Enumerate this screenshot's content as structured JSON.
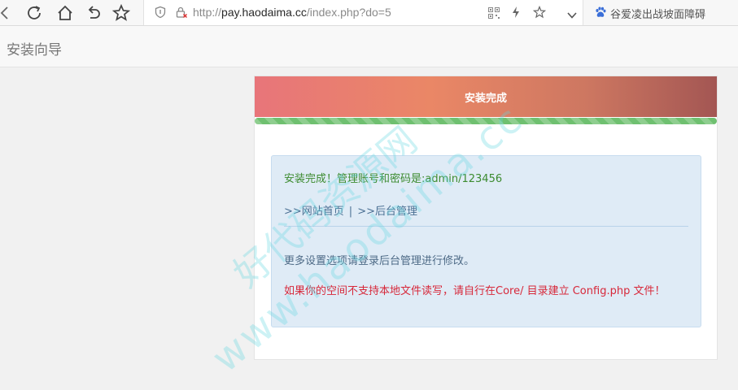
{
  "browser": {
    "url": {
      "scheme": "http://",
      "host": "pay.haodaima.cc",
      "path": "/index.php?do=5"
    },
    "search_hint": "谷爱凌出战坡面障碍"
  },
  "page": {
    "brand": "安装向导"
  },
  "panel": {
    "title": "安装完成",
    "progress_percent": 100,
    "success_message": "安装完成！管理账号和密码是:admin/123456",
    "link_home": ">>网站首页",
    "link_separator": "|",
    "link_admin": ">>后台管理",
    "more_settings": "更多设置选项请登录后台管理进行修改。",
    "warning": "如果你的空间不支持本地文件读写，请自行在Core/ 目录建立 Config.php 文件！"
  },
  "watermark": {
    "line1": "好代码资源网",
    "line2": "www.haodaima.cc"
  },
  "icons": [
    "back-icon",
    "refresh-icon",
    "home-icon",
    "undo-icon",
    "favorite-star-icon",
    "shield-icon",
    "insecure-lock-icon",
    "qr-code-icon",
    "lightning-icon",
    "bookmark-star-icon",
    "chevron-down-icon",
    "baidu-paw-icon"
  ],
  "colors": {
    "heading_gradient_start": "#e8757a",
    "heading_gradient_end": "#a35653",
    "progress": "#6fc070",
    "alert_bg": "#dfebf6",
    "success_text": "#3c8b2f",
    "warning_text": "#d7283a"
  }
}
